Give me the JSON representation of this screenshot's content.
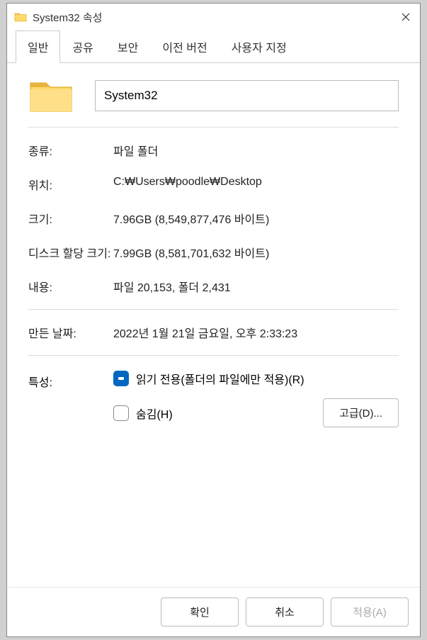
{
  "titlebar": {
    "title": "System32 속성"
  },
  "tabs": {
    "general": "일반",
    "sharing": "공유",
    "security": "보안",
    "previous": "이전 버전",
    "customize": "사용자 지정"
  },
  "name_field": {
    "value": "System32"
  },
  "properties": {
    "type_label": "종류:",
    "type_value": "파일 폴더",
    "location_label": "위치:",
    "location_value": "C:₩Users₩poodle₩Desktop",
    "size_label": "크기:",
    "size_value": "7.96GB (8,549,877,476 바이트)",
    "size_on_disk_label": "디스크 할당 크기:",
    "size_on_disk_value": "7.99GB (8,581,701,632 바이트)",
    "contains_label": "내용:",
    "contains_value": "파일 20,153, 폴더 2,431",
    "created_label": "만든 날짜:",
    "created_value": "2022년 1월 21일 금요일, 오후 2:33:23"
  },
  "attributes": {
    "label": "특성:",
    "readonly_label": "읽기 전용(폴더의 파일에만 적용)(R)",
    "readonly_checked": true,
    "hidden_label": "숨김(H)",
    "hidden_checked": false,
    "advanced_button": "고급(D)..."
  },
  "footer": {
    "ok": "확인",
    "cancel": "취소",
    "apply": "적용(A)"
  }
}
